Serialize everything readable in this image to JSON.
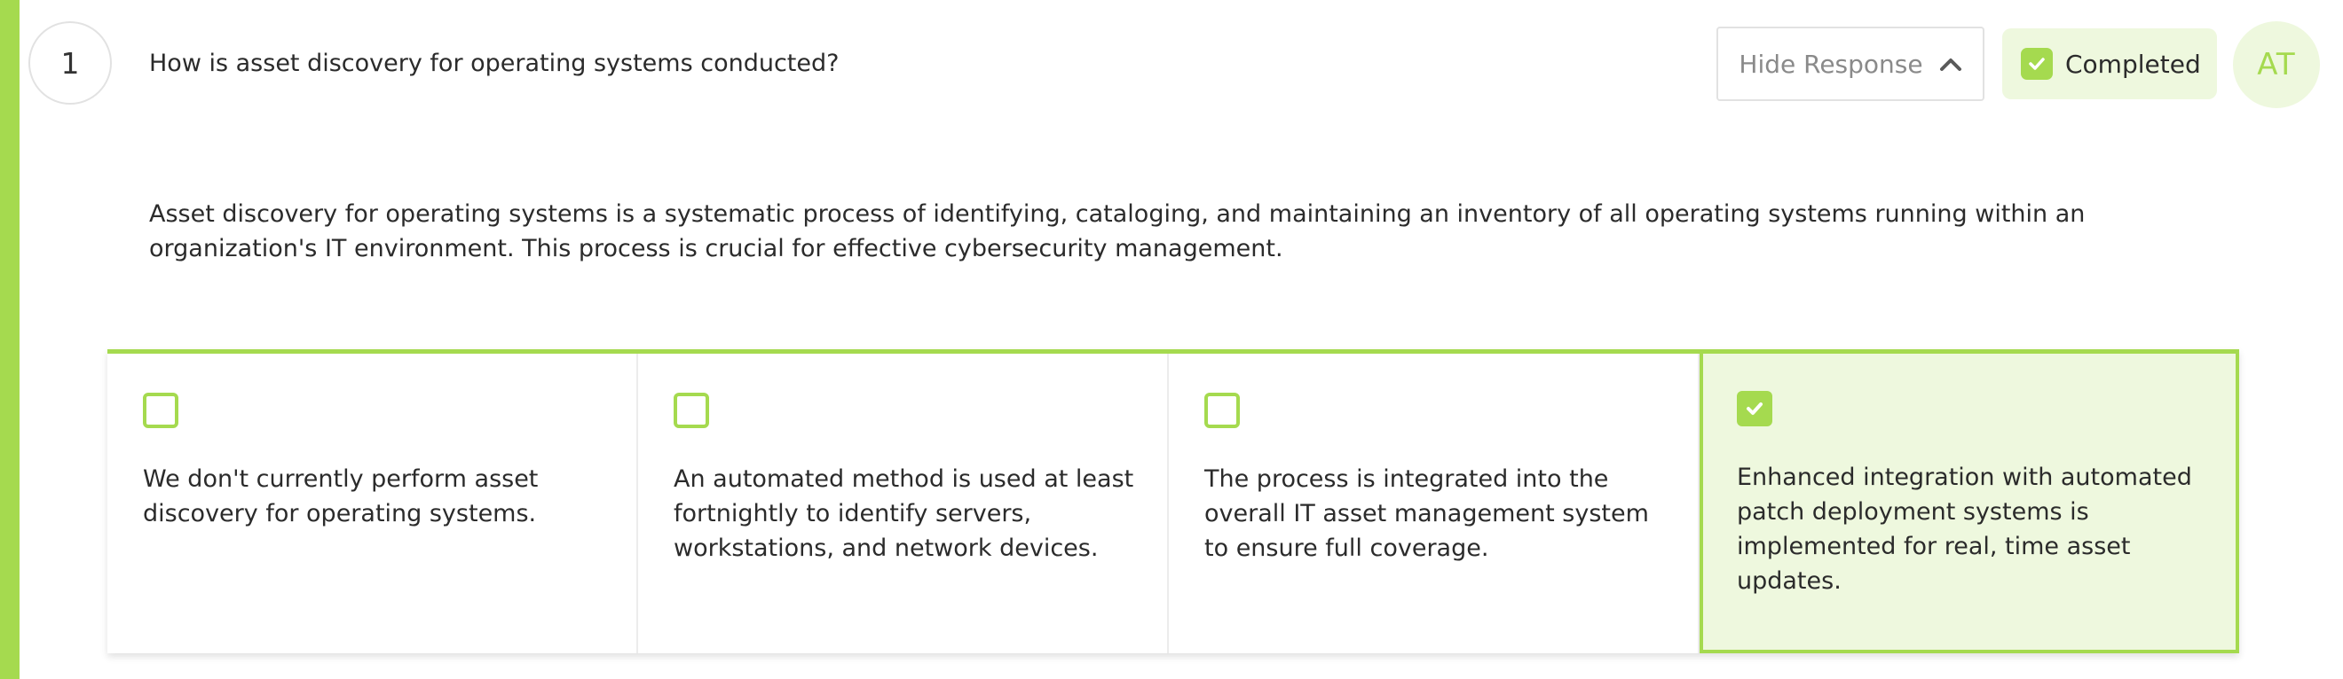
{
  "question": {
    "number": "1",
    "text": "How is asset discovery for operating systems conducted?"
  },
  "header": {
    "hide_response_label": "Hide Response",
    "status_label": "Completed",
    "avatar_initials": "AT"
  },
  "description": "Asset discovery for operating systems is a systematic process of identifying, cataloging, and maintaining an inventory of all operating systems running within an organization's IT environment. This process is crucial for effective cybersecurity management.",
  "options": [
    {
      "text": "We don't currently perform asset discovery for operating systems.",
      "selected": false
    },
    {
      "text": "An automated method is used at least fortnightly to identify servers, workstations, and network devices.",
      "selected": false
    },
    {
      "text": "The process is integrated into the overall IT asset management system to ensure full coverage.",
      "selected": false
    },
    {
      "text": "Enhanced integration with automated patch deployment systems is implemented for real, time asset updates.",
      "selected": true
    }
  ],
  "colors": {
    "accent": "#a5da4f",
    "accent_light": "#eef8de",
    "text": "#2b2b2b",
    "muted": "#8a8a8a",
    "border": "#e2e2e2"
  },
  "icons": {
    "hide_response": "chevron-up-icon",
    "status": "checkmark-icon",
    "selected_option": "checkmark-icon"
  }
}
